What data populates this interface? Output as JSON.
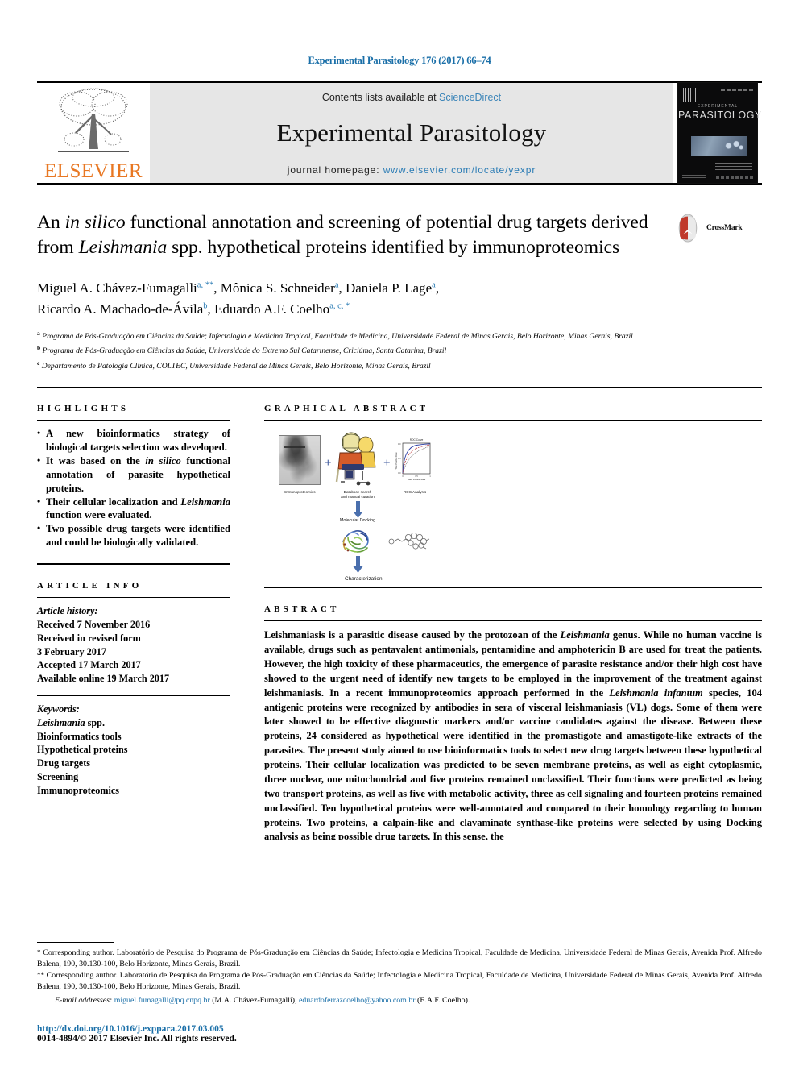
{
  "running_head": "Experimental Parasitology 176 (2017) 66–74",
  "masthead": {
    "publisher_name": "ELSEVIER",
    "contents_prefix": "Contents lists available at ",
    "contents_link": "ScienceDirect",
    "journal_name": "Experimental Parasitology",
    "homepage_label": "journal homepage: ",
    "homepage_url": "www.elsevier.com/locate/yexpr",
    "cover": {
      "small_title": "EXPERIMENTAL",
      "big_title": "PARASITOLOGY"
    }
  },
  "article": {
    "title_part1": "An ",
    "title_italic1": "in silico",
    "title_part2": " functional annotation and screening of potential drug targets derived from ",
    "title_italic2": "Leishmania",
    "title_part3": " spp. hypothetical proteins identified by immunoproteomics",
    "crossmark_label": "CrossMark",
    "authors_line1": "Miguel A. Chávez-Fumagalli",
    "authors_sup1": "a, **",
    "authors_line1b": ", Mônica S. Schneider",
    "authors_sup2": "a",
    "authors_line1c": ", Daniela P. Lage",
    "authors_sup3": "a",
    "authors_line1d": ",",
    "authors_line2": "Ricardo A. Machado-de-Ávila",
    "authors_sup4": "b",
    "authors_line2b": ", Eduardo A.F. Coelho",
    "authors_sup5": "a, c, *",
    "affiliations": [
      {
        "marker": "a",
        "text": "Programa de Pós-Graduação em Ciências da Saúde; Infectologia e Medicina Tropical, Faculdade de Medicina, Universidade Federal de Minas Gerais, Belo Horizonte, Minas Gerais, Brazil"
      },
      {
        "marker": "b",
        "text": "Programa de Pós-Graduação em Ciências da Saúde, Universidade do Extremo Sul Catarinense, Criciúma, Santa Catarina, Brazil"
      },
      {
        "marker": "c",
        "text": "Departamento de Patologia Clínica, COLTEC, Universidade Federal de Minas Gerais, Belo Horizonte, Minas Gerais, Brazil"
      }
    ]
  },
  "highlights": {
    "heading": "HIGHLIGHTS",
    "items": [
      {
        "pre": "A new bioinformatics strategy of biological targets selection was developed.",
        "italic": "",
        "post": ""
      },
      {
        "pre": "It was based on the ",
        "italic": "in silico",
        "post": " functional annotation of parasite hypothetical proteins."
      },
      {
        "pre": "Their cellular localization and ",
        "italic": "Leishmania",
        "post": " function were evaluated."
      },
      {
        "pre": "Two possible drug targets were identified and could be biologically validated.",
        "italic": "",
        "post": ""
      }
    ]
  },
  "article_info": {
    "heading": "ARTICLE INFO",
    "history_label": "Article history:",
    "history": [
      "Received 7 November 2016",
      "Received in revised form",
      "3 February 2017",
      "Accepted 17 March 2017",
      "Available online 19 March 2017"
    ],
    "keywords_label": "Keywords:",
    "keywords": [
      {
        "italic": "Leishmania",
        "rest": " spp."
      },
      {
        "italic": "",
        "rest": "Bioinformatics tools"
      },
      {
        "italic": "",
        "rest": "Hypothetical proteins"
      },
      {
        "italic": "",
        "rest": "Drug targets"
      },
      {
        "italic": "",
        "rest": "Screening"
      },
      {
        "italic": "",
        "rest": "Immunoproteomics"
      }
    ]
  },
  "graphical_abstract": {
    "heading": "GRAPHICAL ABSTRACT",
    "captions": {
      "immunoproteomics": "Immunoproteomics",
      "database_search": "Database search\nand manual curation",
      "roc_analysis": "ROC Analysis",
      "molecular_docking": "Molecular Docking",
      "characterization": "Characterization",
      "plus": "+"
    },
    "roc_title": "ROC Curve",
    "roc_xlabel": "False Positive Rate",
    "roc_ylabel": "True Positive Rate"
  },
  "abstract": {
    "heading": "ABSTRACT",
    "paragraph_parts": [
      {
        "t": "Leishmaniasis is a parasitic disease caused by the protozoan of the "
      },
      {
        "t": "Leishmania",
        "i": true
      },
      {
        "t": " genus. While no human vaccine is available, drugs such as pentavalent antimonials, pentamidine and amphotericin B are used for treat the patients. However, the high toxicity of these pharmaceutics, the emergence of parasite resistance and/or their high cost have showed to the urgent need of identify new targets to be employed in the improvement of the treatment against leishmaniasis. In a recent immunoproteomics approach performed in the "
      },
      {
        "t": "Leishmania infantum",
        "i": true
      },
      {
        "t": " species, 104 antigenic proteins were recognized by antibodies in sera of visceral leishmaniasis (VL) dogs. Some of them were later showed to be effective diagnostic markers and/or vaccine candidates against the disease. Between these proteins, 24 considered as hypothetical were identified in the promastigote and amastigote-like extracts of the parasites. The present study aimed to use bioinformatics tools to select new drug targets between these hypothetical proteins. Their cellular localization was predicted to be seven membrane proteins, as well as eight cytoplasmic, three nuclear, one mitochondrial and five proteins remained unclassified. Their functions were predicted as being two transport proteins, as well as five with metabolic activity, three as cell signaling and fourteen proteins remained unclassified. Ten hypothetical proteins were well-annotated and compared to their homology regarding to human proteins. Two proteins, a calpain-like and clavaminate synthase-like proteins were selected by using Docking analysis as being possible drug targets. In this sense, the"
      }
    ]
  },
  "footnotes": {
    "note1_marker": "*",
    "note1": "Corresponding author. Laboratório de Pesquisa do Programa de Pós-Graduação em Ciências da Saúde; Infectologia e Medicina Tropical, Faculdade de Medicina, Universidade Federal de Minas Gerais, Avenida Prof. Alfredo Balena, 190, 30.130-100, Belo Horizonte, Minas Gerais, Brazil.",
    "note2_marker": "**",
    "note2": "Corresponding author. Laboratório de Pesquisa do Programa de Pós-Graduação em Ciências da Saúde; Infectologia e Medicina Tropical, Faculdade de Medicina, Universidade Federal de Minas Gerais, Avenida Prof. Alfredo Balena, 190, 30.130-100, Belo Horizonte, Minas Gerais, Brazil.",
    "email_label": "E-mail addresses:",
    "email1": "miguel.fumagalli@pq.cnpq.br",
    "email1_owner": " (M.A. Chávez-Fumagalli), ",
    "email2": "eduardoferrazcoelho@yahoo.com.br",
    "email2_owner": " (E.A.F. Coelho)."
  },
  "footer": {
    "doi": "http://dx.doi.org/10.1016/j.exppara.2017.03.005",
    "copyright": "0014-4894/© 2017 Elsevier Inc. All rights reserved."
  },
  "colors": {
    "link_blue": "#1a6fa8",
    "sciencedirect_blue": "#3a84b8",
    "elsevier_orange": "#E87722",
    "arrow_blue": "#4a6fad",
    "crossmark_red": "#c0392b"
  }
}
